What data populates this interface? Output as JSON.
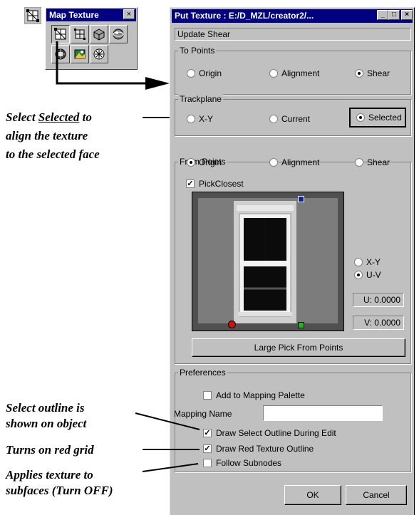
{
  "palette": {
    "title": "Map Texture",
    "close_glyph": "×",
    "tools": [
      "map-texture-tool-icon",
      "frame-tool-icon",
      "box-tool-icon",
      "sphere-tool-icon",
      "cube-tool-icon",
      "photo-tool-icon",
      "snowflake-tool-icon"
    ]
  },
  "dialog": {
    "title": "Put Texture : E:/D_MZL/creator2/...",
    "status": "Update Shear",
    "to_points": {
      "label": "To Points",
      "options": [
        "Origin",
        "Alignment",
        "Shear"
      ],
      "selected": "Shear"
    },
    "trackplane": {
      "label": "Trackplane",
      "options": [
        "X-Y",
        "Current",
        "Selected"
      ],
      "selected": "Selected"
    },
    "from_points": {
      "label": "From Points",
      "options": [
        "Origin",
        "Alignment",
        "Shear"
      ],
      "selected": "Origin"
    },
    "pick_closest": {
      "label": "PickClosest",
      "checked": true
    },
    "space_options": [
      "X-Y",
      "U-V"
    ],
    "space_selected": "U-V",
    "u_value": "U: 0.0000",
    "v_value": "V: 0.0000",
    "large_pick_button": "Large Pick From Points",
    "preferences": {
      "label": "Preferences",
      "add_to_palette": {
        "label": "Add to Mapping Palette",
        "checked": false
      },
      "mapping_name_label": "Mapping Name",
      "mapping_name_value": "",
      "draw_select_outline": {
        "label": "Draw Select Outline During Edit",
        "checked": true
      },
      "draw_red_outline": {
        "label": "Draw Red Texture Outline",
        "checked": true
      },
      "follow_subnodes": {
        "label": "Follow Subnodes",
        "checked": false
      }
    },
    "ok_button": "OK",
    "cancel_button": "Cancel"
  },
  "annotations": {
    "selected_1": "Select ",
    "selected_word": "Selected",
    "selected_2": " to",
    "selected_line2": "align the texture",
    "selected_line3": "to the selected face",
    "outline_line1": "Select outline is",
    "outline_line2": "shown on object",
    "grid": "Turns on red grid",
    "sub_line1": "Applies texture to",
    "sub_line2": "subfaces (Turn OFF)"
  }
}
